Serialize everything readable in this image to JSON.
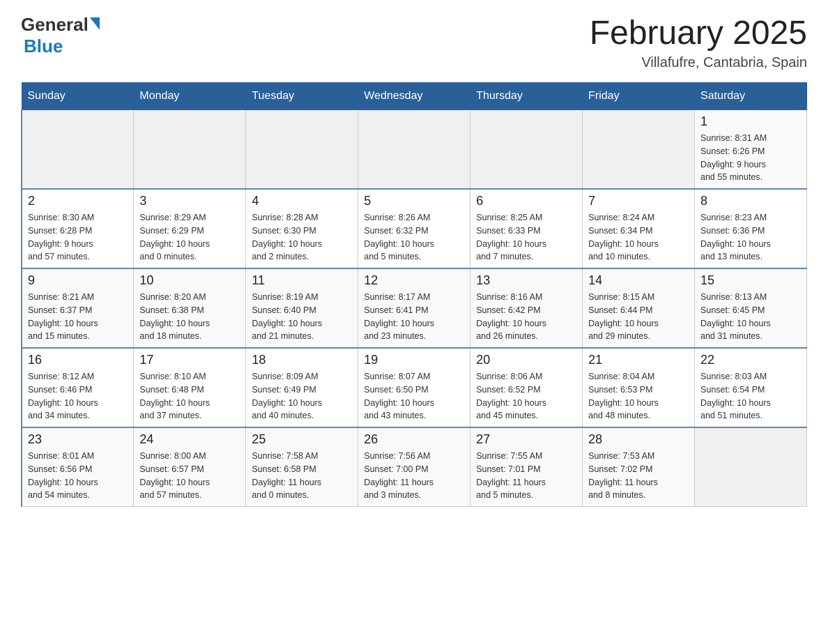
{
  "header": {
    "logo_general": "General",
    "logo_blue": "Blue",
    "month_title": "February 2025",
    "location": "Villafufre, Cantabria, Spain"
  },
  "weekdays": [
    "Sunday",
    "Monday",
    "Tuesday",
    "Wednesday",
    "Thursday",
    "Friday",
    "Saturday"
  ],
  "weeks": [
    [
      {
        "day": "",
        "info": ""
      },
      {
        "day": "",
        "info": ""
      },
      {
        "day": "",
        "info": ""
      },
      {
        "day": "",
        "info": ""
      },
      {
        "day": "",
        "info": ""
      },
      {
        "day": "",
        "info": ""
      },
      {
        "day": "1",
        "info": "Sunrise: 8:31 AM\nSunset: 6:26 PM\nDaylight: 9 hours\nand 55 minutes."
      }
    ],
    [
      {
        "day": "2",
        "info": "Sunrise: 8:30 AM\nSunset: 6:28 PM\nDaylight: 9 hours\nand 57 minutes."
      },
      {
        "day": "3",
        "info": "Sunrise: 8:29 AM\nSunset: 6:29 PM\nDaylight: 10 hours\nand 0 minutes."
      },
      {
        "day": "4",
        "info": "Sunrise: 8:28 AM\nSunset: 6:30 PM\nDaylight: 10 hours\nand 2 minutes."
      },
      {
        "day": "5",
        "info": "Sunrise: 8:26 AM\nSunset: 6:32 PM\nDaylight: 10 hours\nand 5 minutes."
      },
      {
        "day": "6",
        "info": "Sunrise: 8:25 AM\nSunset: 6:33 PM\nDaylight: 10 hours\nand 7 minutes."
      },
      {
        "day": "7",
        "info": "Sunrise: 8:24 AM\nSunset: 6:34 PM\nDaylight: 10 hours\nand 10 minutes."
      },
      {
        "day": "8",
        "info": "Sunrise: 8:23 AM\nSunset: 6:36 PM\nDaylight: 10 hours\nand 13 minutes."
      }
    ],
    [
      {
        "day": "9",
        "info": "Sunrise: 8:21 AM\nSunset: 6:37 PM\nDaylight: 10 hours\nand 15 minutes."
      },
      {
        "day": "10",
        "info": "Sunrise: 8:20 AM\nSunset: 6:38 PM\nDaylight: 10 hours\nand 18 minutes."
      },
      {
        "day": "11",
        "info": "Sunrise: 8:19 AM\nSunset: 6:40 PM\nDaylight: 10 hours\nand 21 minutes."
      },
      {
        "day": "12",
        "info": "Sunrise: 8:17 AM\nSunset: 6:41 PM\nDaylight: 10 hours\nand 23 minutes."
      },
      {
        "day": "13",
        "info": "Sunrise: 8:16 AM\nSunset: 6:42 PM\nDaylight: 10 hours\nand 26 minutes."
      },
      {
        "day": "14",
        "info": "Sunrise: 8:15 AM\nSunset: 6:44 PM\nDaylight: 10 hours\nand 29 minutes."
      },
      {
        "day": "15",
        "info": "Sunrise: 8:13 AM\nSunset: 6:45 PM\nDaylight: 10 hours\nand 31 minutes."
      }
    ],
    [
      {
        "day": "16",
        "info": "Sunrise: 8:12 AM\nSunset: 6:46 PM\nDaylight: 10 hours\nand 34 minutes."
      },
      {
        "day": "17",
        "info": "Sunrise: 8:10 AM\nSunset: 6:48 PM\nDaylight: 10 hours\nand 37 minutes."
      },
      {
        "day": "18",
        "info": "Sunrise: 8:09 AM\nSunset: 6:49 PM\nDaylight: 10 hours\nand 40 minutes."
      },
      {
        "day": "19",
        "info": "Sunrise: 8:07 AM\nSunset: 6:50 PM\nDaylight: 10 hours\nand 43 minutes."
      },
      {
        "day": "20",
        "info": "Sunrise: 8:06 AM\nSunset: 6:52 PM\nDaylight: 10 hours\nand 45 minutes."
      },
      {
        "day": "21",
        "info": "Sunrise: 8:04 AM\nSunset: 6:53 PM\nDaylight: 10 hours\nand 48 minutes."
      },
      {
        "day": "22",
        "info": "Sunrise: 8:03 AM\nSunset: 6:54 PM\nDaylight: 10 hours\nand 51 minutes."
      }
    ],
    [
      {
        "day": "23",
        "info": "Sunrise: 8:01 AM\nSunset: 6:56 PM\nDaylight: 10 hours\nand 54 minutes."
      },
      {
        "day": "24",
        "info": "Sunrise: 8:00 AM\nSunset: 6:57 PM\nDaylight: 10 hours\nand 57 minutes."
      },
      {
        "day": "25",
        "info": "Sunrise: 7:58 AM\nSunset: 6:58 PM\nDaylight: 11 hours\nand 0 minutes."
      },
      {
        "day": "26",
        "info": "Sunrise: 7:56 AM\nSunset: 7:00 PM\nDaylight: 11 hours\nand 3 minutes."
      },
      {
        "day": "27",
        "info": "Sunrise: 7:55 AM\nSunset: 7:01 PM\nDaylight: 11 hours\nand 5 minutes."
      },
      {
        "day": "28",
        "info": "Sunrise: 7:53 AM\nSunset: 7:02 PM\nDaylight: 11 hours\nand 8 minutes."
      },
      {
        "day": "",
        "info": ""
      }
    ]
  ]
}
